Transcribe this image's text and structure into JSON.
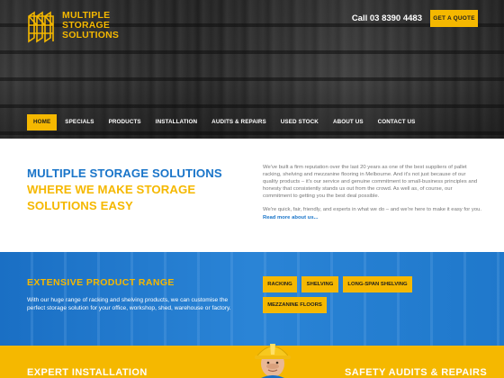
{
  "brand": {
    "logo_lines": [
      "MULTIPLE",
      "STORAGE",
      "SOLUTIONS"
    ],
    "accent": "#f5b800",
    "blue": "#1a75c9"
  },
  "header": {
    "phone": "Call 03 8390 4483",
    "quote_button": "GET A QUOTE"
  },
  "nav": {
    "items": [
      {
        "label": "HOME",
        "active": true
      },
      {
        "label": "SPECIALS"
      },
      {
        "label": "PRODUCTS"
      },
      {
        "label": "INSTALLATION"
      },
      {
        "label": "AUDITS & REPAIRS"
      },
      {
        "label": "USED STOCK"
      },
      {
        "label": "ABOUT US"
      },
      {
        "label": "CONTACT US"
      }
    ]
  },
  "intro": {
    "headline_blue": "MULTIPLE STORAGE SOLUTIONS",
    "headline_yellow_1": "WHERE WE MAKE STORAGE",
    "headline_yellow_2": "SOLUTIONS EASY",
    "paragraph_1": "We've built a firm reputation over the last 20 years as one of the best suppliers of pallet racking, shelving and mezzanine flooring in Melbourne. And it's not just because of our quality products – it's our service and genuine commitment to small-business principles and honesty that consistently stands us out from the crowd. As well as, of course, our commitment to getting you the best deal possible.",
    "paragraph_2": "We're quick, fair, friendly, and experts in what we do – and we're here to make it easy for you.",
    "read_more": "Read more about us..."
  },
  "range": {
    "title": "EXTENSIVE PRODUCT RANGE",
    "copy": "With our huge range of racking and shelving products, we can customise the perfect storage solution for your office, workshop, shed, warehouse or factory.",
    "buttons": [
      "RACKING",
      "SHELVING",
      "LONG-SPAN SHELVING",
      "MEZZANINE FLOORS"
    ]
  },
  "bottom": {
    "left": "EXPERT INSTALLATION",
    "right": "SAFETY AUDITS & REPAIRS"
  }
}
